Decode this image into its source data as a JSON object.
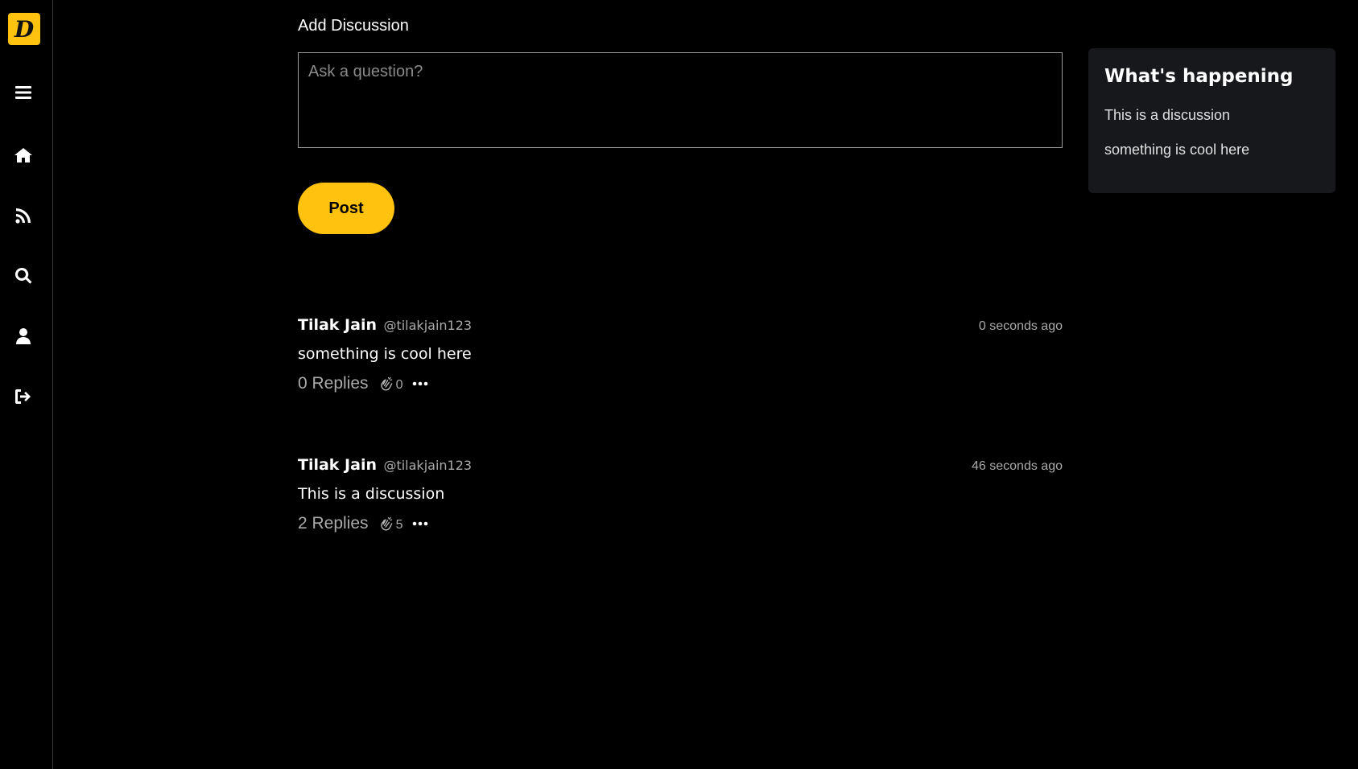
{
  "sidebar": {
    "logo_letter": "D",
    "items": [
      {
        "icon": "menu-icon"
      },
      {
        "icon": "home-icon"
      },
      {
        "icon": "rss-feed-icon"
      },
      {
        "icon": "search-icon"
      },
      {
        "icon": "user-icon"
      },
      {
        "icon": "logout-icon"
      }
    ]
  },
  "composer": {
    "title": "Add Discussion",
    "placeholder": "Ask a question?",
    "post_label": "Post"
  },
  "discussions": [
    {
      "author": "Tilak Jain",
      "handle": "@tilakjain123",
      "time": "0 seconds ago",
      "text": "something is cool here",
      "replies": "0 Replies",
      "claps": "0"
    },
    {
      "author": "Tilak Jain",
      "handle": "@tilakjain123",
      "time": "46 seconds ago",
      "text": "This is a discussion",
      "replies": "2 Replies",
      "claps": "5"
    }
  ],
  "happening": {
    "title": "What's happening",
    "items": [
      "This is a discussion",
      "something is cool here"
    ]
  },
  "colors": {
    "accent": "#ffc20e",
    "background": "#000000",
    "panel": "#17181c",
    "muted_text": "#aaaaaa"
  }
}
